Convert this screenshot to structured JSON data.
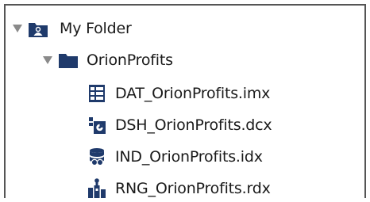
{
  "tree": {
    "root": {
      "label": "My Folder",
      "icon": "user-folder-icon",
      "expanded": true
    },
    "folder": {
      "label": "OrionProfits",
      "icon": "folder-icon",
      "expanded": true
    },
    "items": [
      {
        "label": "DAT_OrionProfits.imx",
        "icon": "data-model-icon"
      },
      {
        "label": "DSH_OrionProfits.dcx",
        "icon": "dashboard-icon"
      },
      {
        "label": "IND_OrionProfits.idx",
        "icon": "index-database-icon"
      },
      {
        "label": "RNG_OrionProfits.rdx",
        "icon": "range-chart-icon"
      }
    ]
  },
  "colors": {
    "icon_navy": "#1f3a6b",
    "toggle_gray": "#8a8a8a",
    "border": "#555555",
    "text": "#1a1a1a"
  }
}
